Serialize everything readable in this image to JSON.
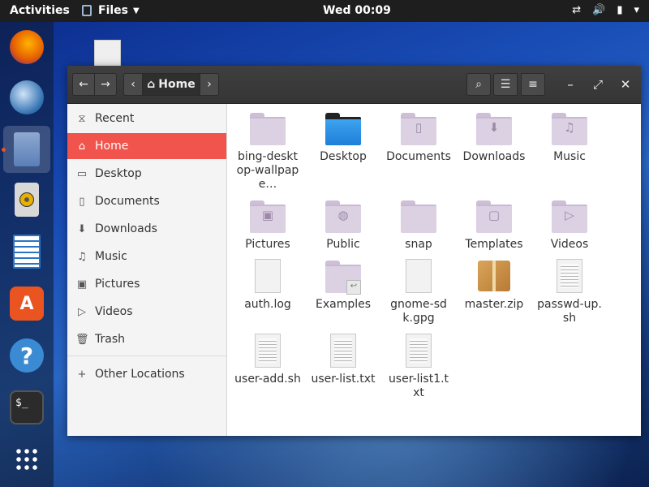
{
  "topbar": {
    "activities": "Activities",
    "app_name": "Files",
    "clock": "Wed 00:09",
    "tray": {
      "network_icon": "⇄",
      "volume_icon": "🔊",
      "battery_icon": "▮",
      "menu_icon": "▾"
    }
  },
  "dock": {
    "items": [
      {
        "name": "Firefox",
        "color": "#e66000"
      },
      {
        "name": "Thunderbird",
        "color": "#2f6fb0"
      },
      {
        "name": "Files",
        "color": "#5a7fb8"
      },
      {
        "name": "Rhythmbox",
        "color": "#e8b000"
      },
      {
        "name": "LibreOffice Writer",
        "color": "#2a74c5"
      },
      {
        "name": "Ubuntu Software",
        "color": "#e95420"
      },
      {
        "name": "Help",
        "color": "#3b8bd4",
        "glyph": "?"
      },
      {
        "name": "Terminal",
        "color": "#2b2b2b",
        "glyph": "$_"
      },
      {
        "name": "Show Applications",
        "glyph": "⋮⋮⋮"
      }
    ]
  },
  "header": {
    "back_glyph": "←",
    "forward_glyph": "→",
    "path_left_glyph": "‹",
    "path_home_icon": "⌂",
    "path_home_label": "Home",
    "path_right_glyph": "›",
    "search_glyph": "⌕",
    "view_glyph": "☰",
    "menu_glyph": "≡",
    "minimize_glyph": "–",
    "maximize_glyph": "⤢",
    "close_glyph": "✕"
  },
  "sidebar": {
    "items": [
      {
        "label": "Recent",
        "icon": "⧖"
      },
      {
        "label": "Home",
        "icon": "⌂"
      },
      {
        "label": "Desktop",
        "icon": "▭"
      },
      {
        "label": "Documents",
        "icon": "▯"
      },
      {
        "label": "Downloads",
        "icon": "⬇"
      },
      {
        "label": "Music",
        "icon": "♫"
      },
      {
        "label": "Pictures",
        "icon": "▣"
      },
      {
        "label": "Videos",
        "icon": "▷"
      },
      {
        "label": "Trash",
        "icon": "🗑"
      }
    ],
    "other_locations": {
      "label": "Other Locations",
      "icon": "+"
    }
  },
  "files": [
    {
      "name": "bing-desktop-wallpape…",
      "type": "folder"
    },
    {
      "name": "Desktop",
      "type": "folder-desktop"
    },
    {
      "name": "Documents",
      "type": "folder",
      "emblem": "▯"
    },
    {
      "name": "Downloads",
      "type": "folder",
      "emblem": "⬇"
    },
    {
      "name": "Music",
      "type": "folder",
      "emblem": "♫"
    },
    {
      "name": "Pictures",
      "type": "folder",
      "emblem": "▣"
    },
    {
      "name": "Public",
      "type": "folder",
      "emblem": "◍"
    },
    {
      "name": "snap",
      "type": "folder"
    },
    {
      "name": "Templates",
      "type": "folder",
      "emblem": "▢"
    },
    {
      "name": "Videos",
      "type": "folder",
      "emblem": "▷"
    },
    {
      "name": "auth.log",
      "type": "file"
    },
    {
      "name": "Examples",
      "type": "folder-link",
      "emblem": "↩"
    },
    {
      "name": "gnome-sdk.gpg",
      "type": "file"
    },
    {
      "name": "master.zip",
      "type": "zip"
    },
    {
      "name": "passwd-up.sh",
      "type": "script"
    },
    {
      "name": "user-add.sh",
      "type": "script"
    },
    {
      "name": "user-list.txt",
      "type": "text"
    },
    {
      "name": "user-list1.txt",
      "type": "text"
    }
  ]
}
